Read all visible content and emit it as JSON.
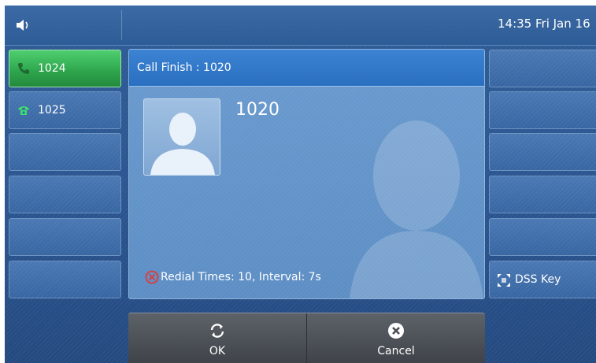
{
  "status_bar": {
    "volume_icon": "speaker-icon",
    "datetime": "14:35 Fri Jan 16"
  },
  "line_keys": [
    {
      "label": "1024",
      "icon": "phone-handset-icon",
      "active": true
    },
    {
      "label": "1025",
      "icon": "phone-registered-icon",
      "active": false
    },
    {
      "label": ""
    },
    {
      "label": ""
    },
    {
      "label": ""
    },
    {
      "label": ""
    }
  ],
  "right_keys": [
    {
      "label": ""
    },
    {
      "label": ""
    },
    {
      "label": ""
    },
    {
      "label": ""
    },
    {
      "label": ""
    },
    {
      "label": "DSS Key",
      "icon": "dss-key-icon"
    }
  ],
  "call_panel": {
    "title": "Call Finish : 1020",
    "caller": "1020",
    "redial_status": "Redial Times: 10, Interval: 7s"
  },
  "softkeys": {
    "ok_label": "OK",
    "cancel_label": "Cancel"
  },
  "colors": {
    "active_key": "#2da44c",
    "panel_header": "#2a6fc0",
    "redial_icon": "#e03a3a"
  }
}
